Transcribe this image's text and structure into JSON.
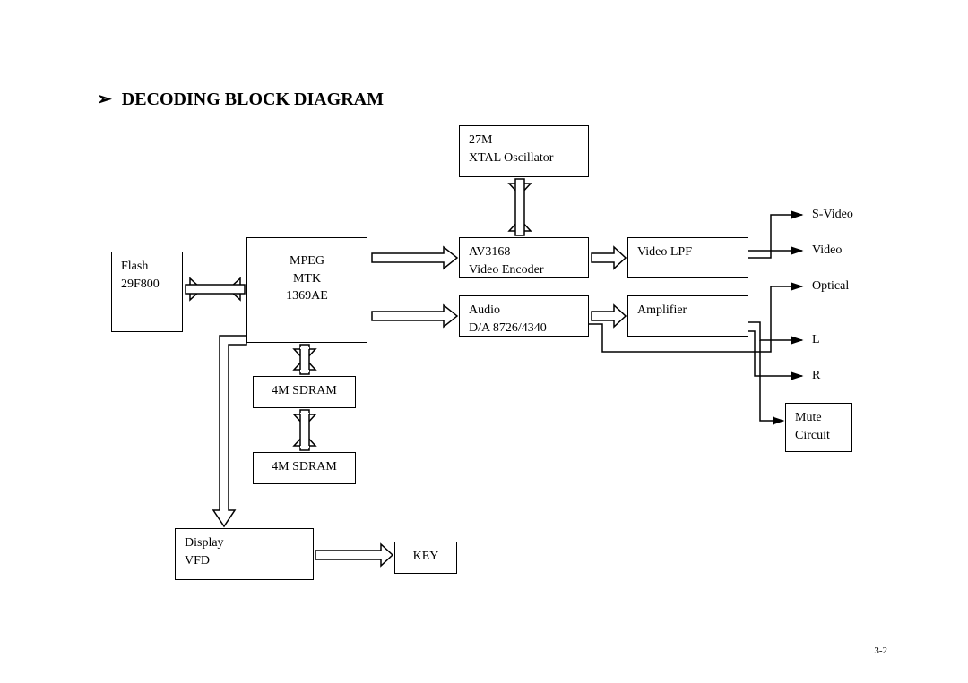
{
  "title": "DECODING BLOCK DIAGRAM",
  "blocks": {
    "xtal": {
      "l1": "27M",
      "l2": "XTAL Oscillator"
    },
    "flash": {
      "l1": "Flash",
      "l2": "29F800"
    },
    "mpeg": {
      "l1": "MPEG",
      "l2": "MTK",
      "l3": "1369AE"
    },
    "venc": {
      "l1": "AV3168",
      "l2": "Video Encoder"
    },
    "vlpf": {
      "l1": "Video LPF"
    },
    "adac": {
      "l1": "Audio",
      "l2": "D/A 8726/4340"
    },
    "amp": {
      "l1": "Amplifier"
    },
    "sdram1": {
      "l1": "4M SDRAM"
    },
    "sdram2": {
      "l1": "4M SDRAM"
    },
    "display": {
      "l1": "Display",
      "l2": "VFD"
    },
    "key": {
      "l1": "KEY"
    },
    "mute": {
      "l1": "Mute",
      "l2": "Circuit"
    }
  },
  "outputs": {
    "svideo": "S-Video",
    "video": "Video",
    "optical": "Optical",
    "l": "L",
    "r": "R"
  },
  "pagenum": "3-2"
}
